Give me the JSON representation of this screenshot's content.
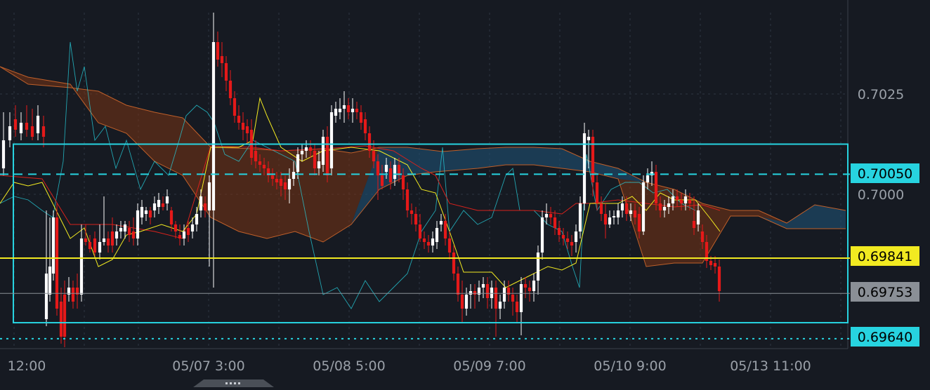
{
  "chart_data": {
    "type": "candlestick",
    "instrument_note": "",
    "y_axis": {
      "range": [
        0.69615,
        0.70155
      ],
      "tick_labels": [
        "0.7025",
        "0.7000"
      ],
      "tick_values": [
        0.7025,
        0.7
      ]
    },
    "x_axis": {
      "tick_labels": [
        "12:00",
        "05/07 3:00",
        "05/08 5:00",
        "05/09 7:00",
        "05/10 9:00",
        "05/13 11:00"
      ]
    },
    "price_labels": [
      {
        "text": "0.70050",
        "value": 0.7005,
        "style": "cyan-dashed"
      },
      {
        "text": "0.69841",
        "value": 0.69841,
        "style": "yellow-solid"
      },
      {
        "text": "0.69753",
        "value": 0.69753,
        "style": "gray-current"
      },
      {
        "text": "0.69640",
        "value": 0.6964,
        "style": "cyan-dotted"
      }
    ],
    "box_range": {
      "high": 0.70125,
      "low": 0.6968
    },
    "grid": true,
    "colors": {
      "bg": "#161a22",
      "grid": "#2f3642",
      "up": "#ffffff",
      "down": "#e51919",
      "cyan": "#27d3e0",
      "yellow": "#f2ea21",
      "cloud_bear": "#7a3414",
      "cloud_bull": "#1e4d6e",
      "label_text": "#000000",
      "axis_text": "#9aa0a8"
    }
  }
}
